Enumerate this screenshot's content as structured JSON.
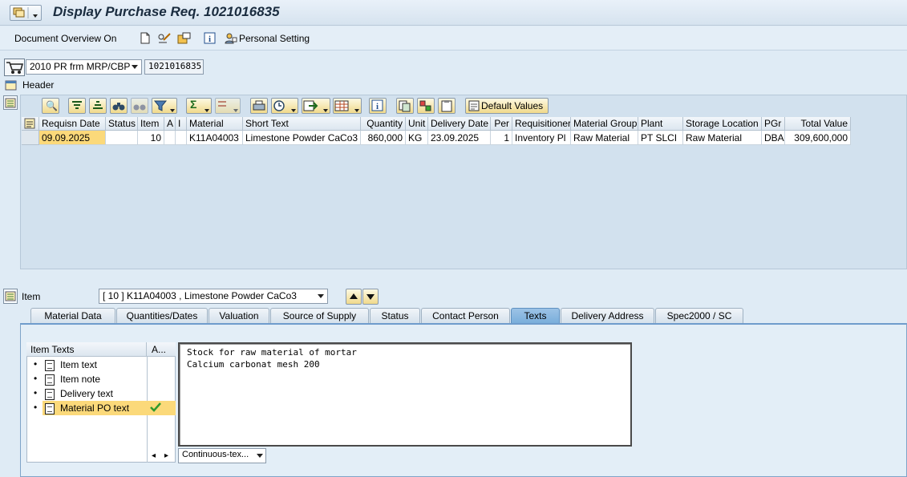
{
  "title": "Display Purchase Req. 1021016835",
  "toolbar": {
    "doc_overview_label": "Document Overview On",
    "personal_setting_label": "Personal Setting"
  },
  "header_row": {
    "doc_type_value": "2010 PR frm MRP/CBP",
    "pr_number": "1021016835",
    "header_label": "Header"
  },
  "grid_toolbar": {
    "default_values_label": "Default Values"
  },
  "grid": {
    "columns": [
      "Requisn Date",
      "Status",
      "Item",
      "A",
      "I",
      "Material",
      "Short Text",
      "Quantity",
      "Unit",
      "Delivery Date",
      "Per",
      "Requisitioner",
      "Material Group",
      "Plant",
      "Storage Location",
      "PGr",
      "Total Value"
    ],
    "rows": [
      [
        "09.09.2025",
        "",
        "10",
        "",
        "",
        "K11A04003",
        "Limestone Powder CaCo3",
        "860,000",
        "KG",
        "23.09.2025",
        "1",
        "Inventory Pl",
        "Raw Material",
        "PT SLCI",
        "Raw Material",
        "DBA",
        "309,600,000"
      ]
    ]
  },
  "item_section": {
    "label": "Item",
    "selected_item": "[ 10 ] K11A04003 , Limestone Powder CaCo3"
  },
  "tabs": [
    "Material Data",
    "Quantities/Dates",
    "Valuation",
    "Source of Supply",
    "Status",
    "Contact Person",
    "Texts",
    "Delivery Address",
    "Spec2000 / SC"
  ],
  "active_tab": "Texts",
  "texts_tab": {
    "tree_header_col1": "Item Texts",
    "tree_header_col2": "A...",
    "tree_items": [
      "Item text",
      "Item note",
      "Delivery text",
      "Material PO text"
    ],
    "selected_item": "Material PO text",
    "editor_lines": [
      "Stock for raw material of mortar",
      "Calcium carbonat mesh 200"
    ],
    "format_select": "Continuous-tex..."
  },
  "colors": {
    "background": "#dfebf5",
    "grid_area": "#d2e1ee",
    "active_tab": "#7aaedb",
    "selected_cell": "#fbd97a",
    "check": "#2e9a2e"
  }
}
